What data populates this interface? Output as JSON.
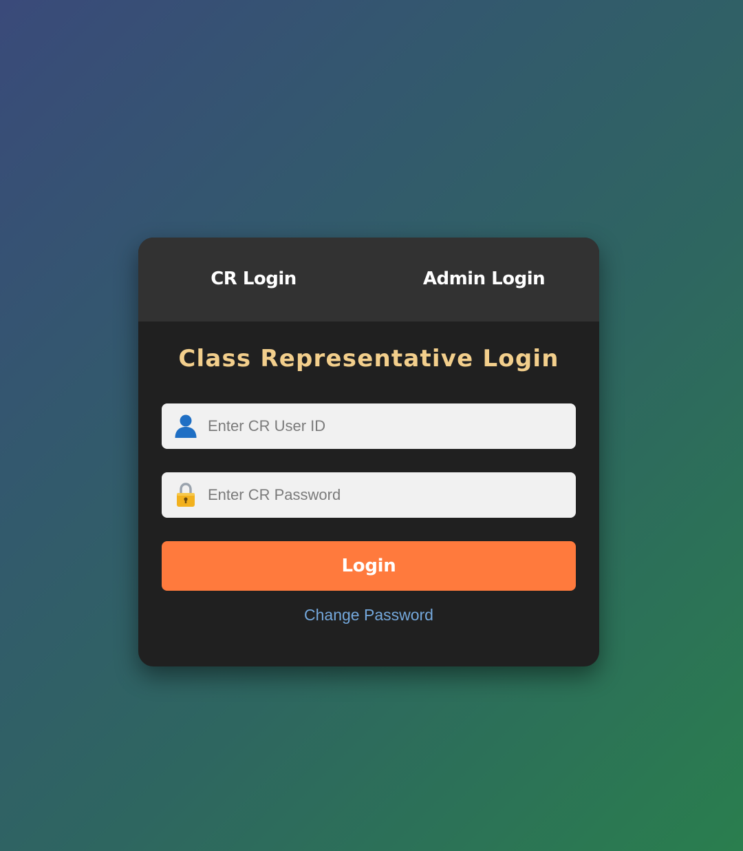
{
  "tabs": {
    "cr_label": "CR Login",
    "admin_label": "Admin Login"
  },
  "form": {
    "title": "Class Representative Login",
    "user_id_placeholder": "Enter CR User ID",
    "user_id_value": "",
    "password_placeholder": "Enter CR Password",
    "password_value": "",
    "user_icon": "user-icon",
    "lock_icon": "lock-icon",
    "login_label": "Login",
    "change_password_label": "Change Password"
  },
  "colors": {
    "title": "#f3cf8c",
    "login_button": "#ff7a3d",
    "link": "#74a8dc",
    "card": "#202020",
    "tab_bar": "#323232"
  }
}
